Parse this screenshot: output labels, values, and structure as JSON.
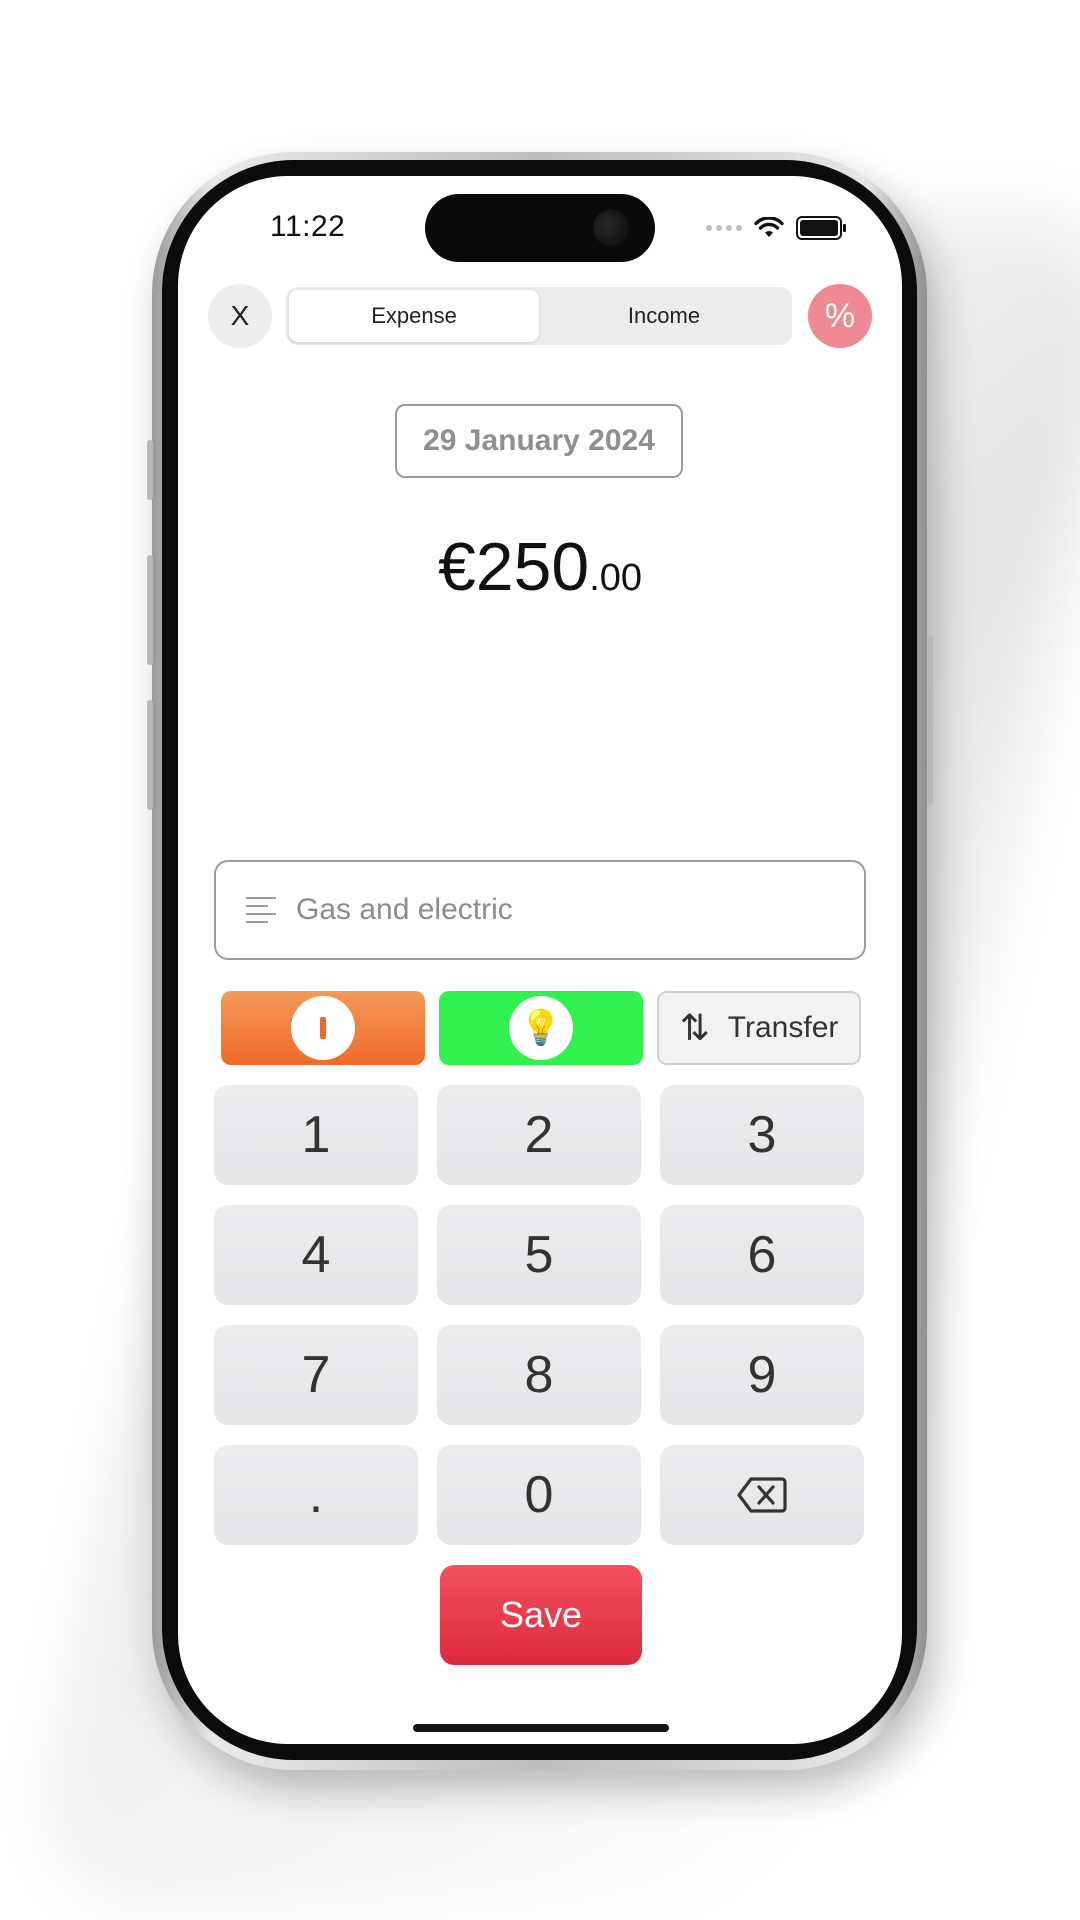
{
  "status_bar": {
    "time": "11:22"
  },
  "header": {
    "close_label": "X",
    "segments": [
      {
        "label": "Expense",
        "active": true
      },
      {
        "label": "Income",
        "active": false
      }
    ],
    "percent_label": "%"
  },
  "date": {
    "label": "29 January 2024"
  },
  "amount": {
    "main": "€250",
    "decimals": ".00"
  },
  "note": {
    "value": "Gas and electric",
    "icon": "text-lines-icon"
  },
  "categories": [
    {
      "name": "orange-category",
      "color": "#EF6A2B",
      "icon": "i-bar-icon"
    },
    {
      "name": "green-category",
      "color": "#2FF24D",
      "icon": "lightbulb-icon",
      "glyph": "💡"
    },
    {
      "name": "transfer",
      "label": "Transfer",
      "icon": "swap-arrows-icon",
      "glyph": "⇅"
    }
  ],
  "keypad": {
    "keys": [
      "1",
      "2",
      "3",
      "4",
      "5",
      "6",
      "7",
      "8",
      "9",
      ".",
      "0",
      "⌫"
    ]
  },
  "save": {
    "label": "Save",
    "color": "#DC2A3C"
  },
  "colors": {
    "percent_button": "#EF8A92",
    "accent_red": "#DC2A3C"
  }
}
